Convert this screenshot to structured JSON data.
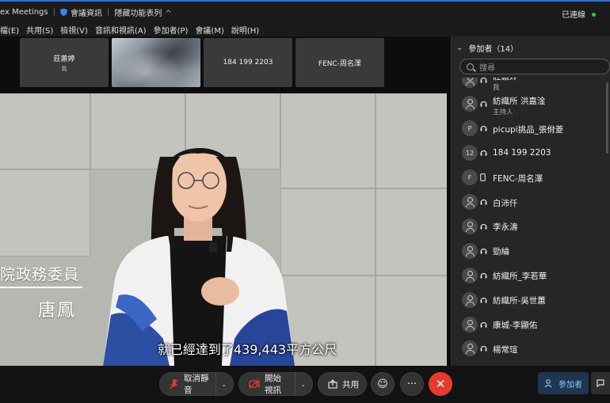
{
  "titlebar": {
    "app": "ex Meetings",
    "meeting_info": "會議資訊",
    "hide_menu": "隱藏功能表列",
    "status": "已連線"
  },
  "menu": [
    "檔(E)",
    "共用(S)",
    "檢視(V)",
    "音訊和視訊(A)",
    "參加者(P)",
    "會議(M)",
    "說明(H)"
  ],
  "thumbnails": [
    {
      "name": "莊蕙婷",
      "sub": "我"
    },
    {
      "name": "",
      "sub": ""
    },
    {
      "name": "184 199 2203",
      "sub": ""
    },
    {
      "name": "FENC-周名澤",
      "sub": ""
    }
  ],
  "video": {
    "lower_third_title": "院政務委員",
    "lower_third_name": "唐鳳",
    "subtitle": "就已經達到了439,443平方公尺"
  },
  "participants_panel": {
    "header": "參加者（14）",
    "search_placeholder": "搜尋",
    "items": [
      {
        "name": "莊蕙婷",
        "sub": "我",
        "avatar": "person-icon",
        "device": "mic"
      },
      {
        "name": "紡織所 洪嘉淦",
        "sub": "主持人",
        "avatar": "person-icon",
        "device": "mic"
      },
      {
        "name": "picupi挑品_張佾菱",
        "sub": "",
        "avatar": "P",
        "device": "mic"
      },
      {
        "name": "184 199 2203",
        "sub": "",
        "avatar": "12",
        "device": "mic"
      },
      {
        "name": "FENC-周名澤",
        "sub": "",
        "avatar": "F",
        "device": "phone"
      },
      {
        "name": "白沛仟",
        "sub": "",
        "avatar": "person-icon",
        "device": "mic"
      },
      {
        "name": "李永濤",
        "sub": "",
        "avatar": "person-icon",
        "device": "mic"
      },
      {
        "name": "勁綸",
        "sub": "",
        "avatar": "person-icon",
        "device": "mic"
      },
      {
        "name": "紡織所_李若華",
        "sub": "",
        "avatar": "person-icon",
        "device": "mic"
      },
      {
        "name": "紡織所-吳世蕙",
        "sub": "",
        "avatar": "person-icon",
        "device": "mic"
      },
      {
        "name": "康城-李顯佑",
        "sub": "",
        "avatar": "person-icon",
        "device": "mic"
      },
      {
        "name": "楊常瑄",
        "sub": "",
        "avatar": "person-icon",
        "device": "mic"
      }
    ]
  },
  "controls": {
    "unmute": "取消靜音",
    "start_video": "開始視訊",
    "share": "共用",
    "participants": "參加者"
  },
  "colors": {
    "end": "#e53b2e",
    "accent": "#2f6fd6",
    "status": "#2ecc40"
  }
}
